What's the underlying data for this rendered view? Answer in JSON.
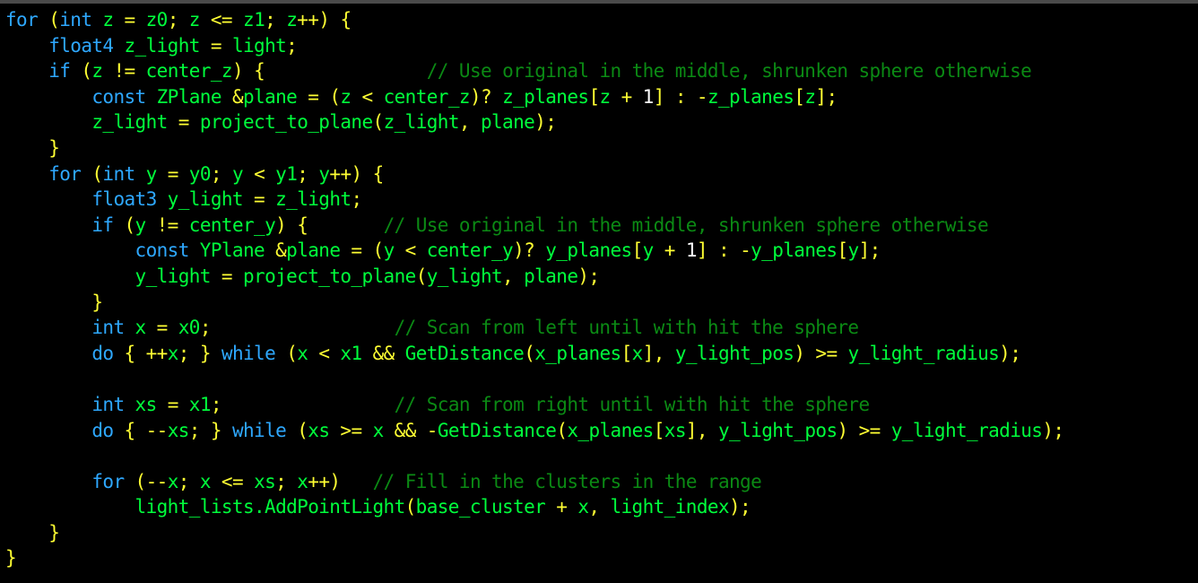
{
  "editor": {
    "background": "#000000",
    "colors": {
      "kw": "#2ea8ff",
      "id": "#00ff3c",
      "op": "#ffff33",
      "num": "#ffffff",
      "type": "#00ff3c",
      "cm": "#0b8a14"
    },
    "lines": [
      [
        [
          "kw",
          "for"
        ],
        [
          "ws",
          " "
        ],
        [
          "op",
          "("
        ],
        [
          "kw",
          "int"
        ],
        [
          "ws",
          " "
        ],
        [
          "id",
          "z"
        ],
        [
          "ws",
          " "
        ],
        [
          "op",
          "="
        ],
        [
          "ws",
          " "
        ],
        [
          "id",
          "z0"
        ],
        [
          "op",
          ";"
        ],
        [
          "ws",
          " "
        ],
        [
          "id",
          "z"
        ],
        [
          "ws",
          " "
        ],
        [
          "op",
          "<="
        ],
        [
          "ws",
          " "
        ],
        [
          "id",
          "z1"
        ],
        [
          "op",
          ";"
        ],
        [
          "ws",
          " "
        ],
        [
          "id",
          "z"
        ],
        [
          "op",
          "++)"
        ],
        [
          "ws",
          " "
        ],
        [
          "op",
          "{"
        ]
      ],
      [
        [
          "ws",
          "    "
        ],
        [
          "kw",
          "float4"
        ],
        [
          "ws",
          " "
        ],
        [
          "id",
          "z_light"
        ],
        [
          "ws",
          " "
        ],
        [
          "op",
          "="
        ],
        [
          "ws",
          " "
        ],
        [
          "id",
          "light"
        ],
        [
          "op",
          ";"
        ]
      ],
      [
        [
          "ws",
          "    "
        ],
        [
          "kw",
          "if"
        ],
        [
          "ws",
          " "
        ],
        [
          "op",
          "("
        ],
        [
          "id",
          "z"
        ],
        [
          "ws",
          " "
        ],
        [
          "op",
          "!="
        ],
        [
          "ws",
          " "
        ],
        [
          "id",
          "center_z"
        ],
        [
          "op",
          ")"
        ],
        [
          "ws",
          " "
        ],
        [
          "op",
          "{"
        ],
        [
          "ws",
          "               "
        ],
        [
          "cm",
          "// Use original in the middle, shrunken sphere otherwise"
        ]
      ],
      [
        [
          "ws",
          "        "
        ],
        [
          "kw",
          "const"
        ],
        [
          "ws",
          " "
        ],
        [
          "type",
          "ZPlane"
        ],
        [
          "ws",
          " "
        ],
        [
          "op",
          "&"
        ],
        [
          "id",
          "plane"
        ],
        [
          "ws",
          " "
        ],
        [
          "op",
          "="
        ],
        [
          "ws",
          " "
        ],
        [
          "op",
          "("
        ],
        [
          "id",
          "z"
        ],
        [
          "ws",
          " "
        ],
        [
          "op",
          "<"
        ],
        [
          "ws",
          " "
        ],
        [
          "id",
          "center_z"
        ],
        [
          "op",
          ")?"
        ],
        [
          "ws",
          " "
        ],
        [
          "id",
          "z_planes"
        ],
        [
          "op",
          "["
        ],
        [
          "id",
          "z"
        ],
        [
          "ws",
          " "
        ],
        [
          "op",
          "+"
        ],
        [
          "ws",
          " "
        ],
        [
          "num",
          "1"
        ],
        [
          "op",
          "]"
        ],
        [
          "ws",
          " "
        ],
        [
          "op",
          ":"
        ],
        [
          "ws",
          " "
        ],
        [
          "op",
          "-"
        ],
        [
          "id",
          "z_planes"
        ],
        [
          "op",
          "["
        ],
        [
          "id",
          "z"
        ],
        [
          "op",
          "];"
        ]
      ],
      [
        [
          "ws",
          "        "
        ],
        [
          "id",
          "z_light"
        ],
        [
          "ws",
          " "
        ],
        [
          "op",
          "="
        ],
        [
          "ws",
          " "
        ],
        [
          "id",
          "project_to_plane"
        ],
        [
          "op",
          "("
        ],
        [
          "id",
          "z_light"
        ],
        [
          "op",
          ","
        ],
        [
          "ws",
          " "
        ],
        [
          "id",
          "plane"
        ],
        [
          "op",
          ");"
        ]
      ],
      [
        [
          "ws",
          "    "
        ],
        [
          "op",
          "}"
        ]
      ],
      [
        [
          "ws",
          "    "
        ],
        [
          "kw",
          "for"
        ],
        [
          "ws",
          " "
        ],
        [
          "op",
          "("
        ],
        [
          "kw",
          "int"
        ],
        [
          "ws",
          " "
        ],
        [
          "id",
          "y"
        ],
        [
          "ws",
          " "
        ],
        [
          "op",
          "="
        ],
        [
          "ws",
          " "
        ],
        [
          "id",
          "y0"
        ],
        [
          "op",
          ";"
        ],
        [
          "ws",
          " "
        ],
        [
          "id",
          "y"
        ],
        [
          "ws",
          " "
        ],
        [
          "op",
          "<"
        ],
        [
          "ws",
          " "
        ],
        [
          "id",
          "y1"
        ],
        [
          "op",
          ";"
        ],
        [
          "ws",
          " "
        ],
        [
          "id",
          "y"
        ],
        [
          "op",
          "++)"
        ],
        [
          "ws",
          " "
        ],
        [
          "op",
          "{"
        ]
      ],
      [
        [
          "ws",
          "        "
        ],
        [
          "kw",
          "float3"
        ],
        [
          "ws",
          " "
        ],
        [
          "id",
          "y_light"
        ],
        [
          "ws",
          " "
        ],
        [
          "op",
          "="
        ],
        [
          "ws",
          " "
        ],
        [
          "id",
          "z_light"
        ],
        [
          "op",
          ";"
        ]
      ],
      [
        [
          "ws",
          "        "
        ],
        [
          "kw",
          "if"
        ],
        [
          "ws",
          " "
        ],
        [
          "op",
          "("
        ],
        [
          "id",
          "y"
        ],
        [
          "ws",
          " "
        ],
        [
          "op",
          "!="
        ],
        [
          "ws",
          " "
        ],
        [
          "id",
          "center_y"
        ],
        [
          "op",
          ")"
        ],
        [
          "ws",
          " "
        ],
        [
          "op",
          "{"
        ],
        [
          "ws",
          "       "
        ],
        [
          "cm",
          "// Use original in the middle, shrunken sphere otherwise"
        ]
      ],
      [
        [
          "ws",
          "            "
        ],
        [
          "kw",
          "const"
        ],
        [
          "ws",
          " "
        ],
        [
          "type",
          "YPlane"
        ],
        [
          "ws",
          " "
        ],
        [
          "op",
          "&"
        ],
        [
          "id",
          "plane"
        ],
        [
          "ws",
          " "
        ],
        [
          "op",
          "="
        ],
        [
          "ws",
          " "
        ],
        [
          "op",
          "("
        ],
        [
          "id",
          "y"
        ],
        [
          "ws",
          " "
        ],
        [
          "op",
          "<"
        ],
        [
          "ws",
          " "
        ],
        [
          "id",
          "center_y"
        ],
        [
          "op",
          ")?"
        ],
        [
          "ws",
          " "
        ],
        [
          "id",
          "y_planes"
        ],
        [
          "op",
          "["
        ],
        [
          "id",
          "y"
        ],
        [
          "ws",
          " "
        ],
        [
          "op",
          "+"
        ],
        [
          "ws",
          " "
        ],
        [
          "num",
          "1"
        ],
        [
          "op",
          "]"
        ],
        [
          "ws",
          " "
        ],
        [
          "op",
          ":"
        ],
        [
          "ws",
          " "
        ],
        [
          "op",
          "-"
        ],
        [
          "id",
          "y_planes"
        ],
        [
          "op",
          "["
        ],
        [
          "id",
          "y"
        ],
        [
          "op",
          "];"
        ]
      ],
      [
        [
          "ws",
          "            "
        ],
        [
          "id",
          "y_light"
        ],
        [
          "ws",
          " "
        ],
        [
          "op",
          "="
        ],
        [
          "ws",
          " "
        ],
        [
          "id",
          "project_to_plane"
        ],
        [
          "op",
          "("
        ],
        [
          "id",
          "y_light"
        ],
        [
          "op",
          ","
        ],
        [
          "ws",
          " "
        ],
        [
          "id",
          "plane"
        ],
        [
          "op",
          ");"
        ]
      ],
      [
        [
          "ws",
          "        "
        ],
        [
          "op",
          "}"
        ]
      ],
      [
        [
          "ws",
          "        "
        ],
        [
          "kw",
          "int"
        ],
        [
          "ws",
          " "
        ],
        [
          "id",
          "x"
        ],
        [
          "ws",
          " "
        ],
        [
          "op",
          "="
        ],
        [
          "ws",
          " "
        ],
        [
          "id",
          "x0"
        ],
        [
          "op",
          ";"
        ],
        [
          "ws",
          "                 "
        ],
        [
          "cm",
          "// Scan from left until with hit the sphere"
        ]
      ],
      [
        [
          "ws",
          "        "
        ],
        [
          "kw",
          "do"
        ],
        [
          "ws",
          " "
        ],
        [
          "op",
          "{"
        ],
        [
          "ws",
          " "
        ],
        [
          "op",
          "++"
        ],
        [
          "id",
          "x"
        ],
        [
          "op",
          ";"
        ],
        [
          "ws",
          " "
        ],
        [
          "op",
          "}"
        ],
        [
          "ws",
          " "
        ],
        [
          "kw",
          "while"
        ],
        [
          "ws",
          " "
        ],
        [
          "op",
          "("
        ],
        [
          "id",
          "x"
        ],
        [
          "ws",
          " "
        ],
        [
          "op",
          "<"
        ],
        [
          "ws",
          " "
        ],
        [
          "id",
          "x1"
        ],
        [
          "ws",
          " "
        ],
        [
          "op",
          "&&"
        ],
        [
          "ws",
          " "
        ],
        [
          "id",
          "GetDistance"
        ],
        [
          "op",
          "("
        ],
        [
          "id",
          "x_planes"
        ],
        [
          "op",
          "["
        ],
        [
          "id",
          "x"
        ],
        [
          "op",
          "],"
        ],
        [
          "ws",
          " "
        ],
        [
          "id",
          "y_light_pos"
        ],
        [
          "op",
          ")"
        ],
        [
          "ws",
          " "
        ],
        [
          "op",
          ">="
        ],
        [
          "ws",
          " "
        ],
        [
          "id",
          "y_light_radius"
        ],
        [
          "op",
          ");"
        ]
      ],
      [],
      [
        [
          "ws",
          "        "
        ],
        [
          "kw",
          "int"
        ],
        [
          "ws",
          " "
        ],
        [
          "id",
          "xs"
        ],
        [
          "ws",
          " "
        ],
        [
          "op",
          "="
        ],
        [
          "ws",
          " "
        ],
        [
          "id",
          "x1"
        ],
        [
          "op",
          ";"
        ],
        [
          "ws",
          "                "
        ],
        [
          "cm",
          "// Scan from right until with hit the sphere"
        ]
      ],
      [
        [
          "ws",
          "        "
        ],
        [
          "kw",
          "do"
        ],
        [
          "ws",
          " "
        ],
        [
          "op",
          "{"
        ],
        [
          "ws",
          " "
        ],
        [
          "op",
          "--"
        ],
        [
          "id",
          "xs"
        ],
        [
          "op",
          ";"
        ],
        [
          "ws",
          " "
        ],
        [
          "op",
          "}"
        ],
        [
          "ws",
          " "
        ],
        [
          "kw",
          "while"
        ],
        [
          "ws",
          " "
        ],
        [
          "op",
          "("
        ],
        [
          "id",
          "xs"
        ],
        [
          "ws",
          " "
        ],
        [
          "op",
          ">="
        ],
        [
          "ws",
          " "
        ],
        [
          "id",
          "x"
        ],
        [
          "ws",
          " "
        ],
        [
          "op",
          "&&"
        ],
        [
          "ws",
          " "
        ],
        [
          "op",
          "-"
        ],
        [
          "id",
          "GetDistance"
        ],
        [
          "op",
          "("
        ],
        [
          "id",
          "x_planes"
        ],
        [
          "op",
          "["
        ],
        [
          "id",
          "xs"
        ],
        [
          "op",
          "],"
        ],
        [
          "ws",
          " "
        ],
        [
          "id",
          "y_light_pos"
        ],
        [
          "op",
          ")"
        ],
        [
          "ws",
          " "
        ],
        [
          "op",
          ">="
        ],
        [
          "ws",
          " "
        ],
        [
          "id",
          "y_light_radius"
        ],
        [
          "op",
          ");"
        ]
      ],
      [],
      [
        [
          "ws",
          "        "
        ],
        [
          "kw",
          "for"
        ],
        [
          "ws",
          " "
        ],
        [
          "op",
          "(--"
        ],
        [
          "id",
          "x"
        ],
        [
          "op",
          ";"
        ],
        [
          "ws",
          " "
        ],
        [
          "id",
          "x"
        ],
        [
          "ws",
          " "
        ],
        [
          "op",
          "<="
        ],
        [
          "ws",
          " "
        ],
        [
          "id",
          "xs"
        ],
        [
          "op",
          ";"
        ],
        [
          "ws",
          " "
        ],
        [
          "id",
          "x"
        ],
        [
          "op",
          "++)"
        ],
        [
          "ws",
          "   "
        ],
        [
          "cm",
          "// Fill in the clusters in the range"
        ]
      ],
      [
        [
          "ws",
          "            "
        ],
        [
          "id",
          "light_lists.AddPointLight"
        ],
        [
          "op",
          "("
        ],
        [
          "id",
          "base_cluster"
        ],
        [
          "ws",
          " "
        ],
        [
          "op",
          "+"
        ],
        [
          "ws",
          " "
        ],
        [
          "id",
          "x"
        ],
        [
          "op",
          ","
        ],
        [
          "ws",
          " "
        ],
        [
          "id",
          "light_index"
        ],
        [
          "op",
          ");"
        ]
      ],
      [
        [
          "ws",
          "    "
        ],
        [
          "op",
          "}"
        ]
      ],
      [
        [
          "op",
          "}"
        ]
      ]
    ]
  }
}
